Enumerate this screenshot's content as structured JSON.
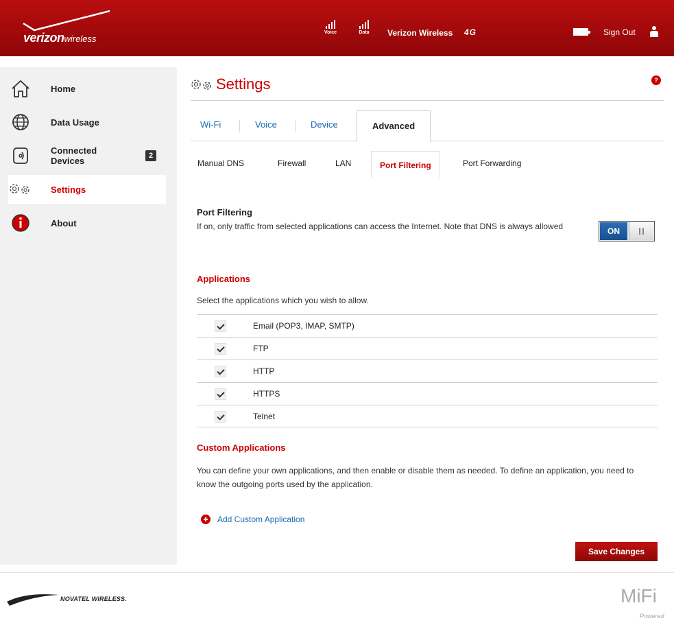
{
  "header": {
    "brand": "verizon",
    "brand_suffix": "wireless",
    "signal_voice_label": "Voice",
    "signal_data_label": "Data",
    "carrier": "Verizon Wireless",
    "network": "4G",
    "sign_out": "Sign Out"
  },
  "sidebar": {
    "items": [
      {
        "label": "Home",
        "icon": "house-icon"
      },
      {
        "label": "Data Usage",
        "icon": "globe-icon"
      },
      {
        "label": "Connected\nDevices",
        "icon": "device-icon",
        "badge": "2"
      },
      {
        "label": "Settings",
        "icon": "gears-icon",
        "active": true
      },
      {
        "label": "About",
        "icon": "info-icon"
      }
    ]
  },
  "main": {
    "title": "Settings",
    "help": "?",
    "tabs": [
      {
        "label": "Wi-Fi"
      },
      {
        "label": "Voice"
      },
      {
        "label": "Device"
      },
      {
        "label": "Advanced",
        "active": true
      }
    ],
    "subtabs": [
      {
        "label": "Manual DNS"
      },
      {
        "label": "Firewall"
      },
      {
        "label": "LAN"
      },
      {
        "label": "Port Filtering",
        "active": true
      },
      {
        "label": "Port Forwarding"
      }
    ],
    "port_filtering": {
      "title": "Port Filtering",
      "description": "If on, only traffic from selected applications can access the Internet. Note that DNS is always allowed",
      "toggle": "ON"
    },
    "applications": {
      "title": "Applications",
      "description": "Select the applications which you wish to allow.",
      "items": [
        {
          "name": "Email (POP3, IMAP, SMTP)",
          "checked": true
        },
        {
          "name": "FTP",
          "checked": true
        },
        {
          "name": "HTTP",
          "checked": true
        },
        {
          "name": "HTTPS",
          "checked": true
        },
        {
          "name": "Telnet",
          "checked": true
        }
      ]
    },
    "custom": {
      "title": "Custom Applications",
      "description": "You can define your own applications, and then enable or disable them as needed. To define an application, you need to know the outgoing ports used by the application.",
      "add_link": "Add Custom Application"
    },
    "save": "Save Changes"
  },
  "footer": {
    "novatel": "NOVATEL WIRELESS.",
    "mifi": "MiFi",
    "mifi_sub": "Powered"
  },
  "colors": {
    "brand_red": "#cc0000",
    "link_blue": "#1a6bb3",
    "toggle_blue": "#1f5fa6"
  }
}
